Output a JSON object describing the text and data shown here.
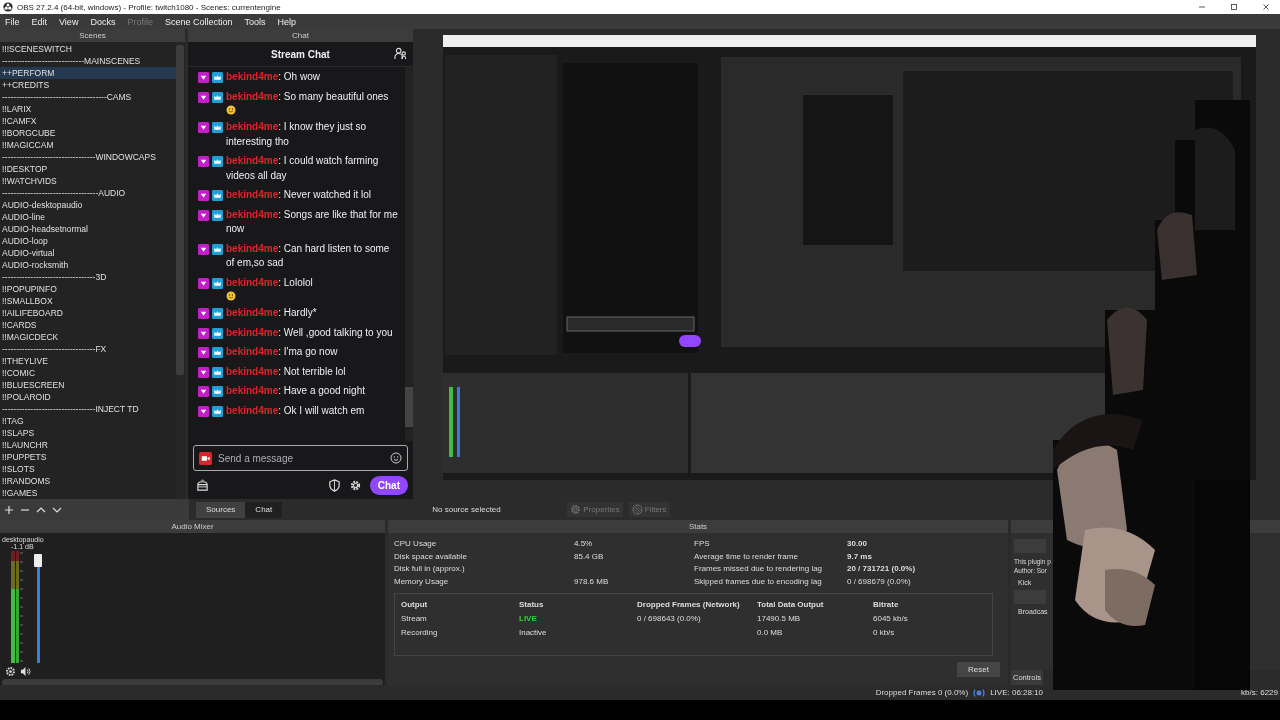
{
  "window": {
    "title": "OBS 27.2.4 (64-bit, windows) - Profile: twitch1080 - Scenes: currentengine"
  },
  "menu": [
    {
      "label": "File",
      "disabled": false
    },
    {
      "label": "Edit",
      "disabled": false
    },
    {
      "label": "View",
      "disabled": false
    },
    {
      "label": "Docks",
      "disabled": false
    },
    {
      "label": "Profile",
      "disabled": true
    },
    {
      "label": "Scene Collection",
      "disabled": false
    },
    {
      "label": "Tools",
      "disabled": false
    },
    {
      "label": "Help",
      "disabled": false
    }
  ],
  "scenes": {
    "title": "Scenes",
    "items": [
      {
        "label": "!!!SCENESWITCH",
        "selected": false
      },
      {
        "label": "-----------------------------MAINSCENES",
        "selected": false
      },
      {
        "label": "++PERFORM",
        "selected": true
      },
      {
        "label": "++CREDITS",
        "selected": false
      },
      {
        "label": "-------------------------------------CAMS",
        "selected": false
      },
      {
        "label": "!!LARIX",
        "selected": false
      },
      {
        "label": "!!CAMFX",
        "selected": false
      },
      {
        "label": "!!BORGCUBE",
        "selected": false
      },
      {
        "label": "!!MAGICCAM",
        "selected": false
      },
      {
        "label": "---------------------------------WINDOWCAPS",
        "selected": false
      },
      {
        "label": "!!DESKTOP",
        "selected": false
      },
      {
        "label": "!!WATCHVIDS",
        "selected": false
      },
      {
        "label": "----------------------------------AUDIO",
        "selected": false
      },
      {
        "label": "AUDIO-desktopaudio",
        "selected": false
      },
      {
        "label": "AUDIO-line",
        "selected": false
      },
      {
        "label": "AUDIO-headsetnormal",
        "selected": false
      },
      {
        "label": "AUDIO-loop",
        "selected": false
      },
      {
        "label": "AUDIO-virtual",
        "selected": false
      },
      {
        "label": "AUDIO-rocksmith",
        "selected": false
      },
      {
        "label": "---------------------------------3D",
        "selected": false
      },
      {
        "label": "!!POPUPINFO",
        "selected": false
      },
      {
        "label": "!!SMALLBOX",
        "selected": false
      },
      {
        "label": "!!AILIFEBOARD",
        "selected": false
      },
      {
        "label": "!!CARDS",
        "selected": false
      },
      {
        "label": "!!MAGICDECK",
        "selected": false
      },
      {
        "label": "---------------------------------FX",
        "selected": false
      },
      {
        "label": "!!THEYLIVE",
        "selected": false
      },
      {
        "label": "!!COMIC",
        "selected": false
      },
      {
        "label": "!!BLUESCREEN",
        "selected": false
      },
      {
        "label": "!!POLAROID",
        "selected": false
      },
      {
        "label": "---------------------------------INJECT TD",
        "selected": false
      },
      {
        "label": "!!TAG",
        "selected": false
      },
      {
        "label": "!!SLAPS",
        "selected": false
      },
      {
        "label": "!!LAUNCHR",
        "selected": false
      },
      {
        "label": "!!PUPPETS",
        "selected": false
      },
      {
        "label": "!!SLOTS",
        "selected": false
      },
      {
        "label": "!!RANDOMS",
        "selected": false
      },
      {
        "label": "!!GAMES",
        "selected": false
      }
    ]
  },
  "chat": {
    "title": "Chat",
    "header": "Stream Chat",
    "messages": [
      {
        "user": "bekind4me",
        "text": ": Oh wow",
        "emoji": false
      },
      {
        "user": "bekind4me",
        "text": ": So many beautiful ones",
        "emoji": true
      },
      {
        "user": "bekind4me",
        "text": ": I know they just so interesting tho",
        "emoji": false
      },
      {
        "user": "bekind4me",
        "text": ": I could watch farming videos all day",
        "emoji": false
      },
      {
        "user": "bekind4me",
        "text": ": Never watched it lol",
        "emoji": false
      },
      {
        "user": "bekind4me",
        "text": ": Songs are like that for me now",
        "emoji": false
      },
      {
        "user": "bekind4me",
        "text": ": Can hard listen to some of em,so sad",
        "emoji": false
      },
      {
        "user": "bekind4me",
        "text": ": Lololol",
        "emoji": true
      },
      {
        "user": "bekind4me",
        "text": ": Hardly*",
        "emoji": false
      },
      {
        "user": "bekind4me",
        "text": ": Well ,good talking to you",
        "emoji": false
      },
      {
        "user": "bekind4me",
        "text": ": I'ma go now",
        "emoji": false
      },
      {
        "user": "bekind4me",
        "text": ": Not terrible lol",
        "emoji": false
      },
      {
        "user": "bekind4me",
        "text": ": Have a good night",
        "emoji": false
      },
      {
        "user": "bekind4me",
        "text": ": Ok I will watch em",
        "emoji": false
      }
    ],
    "input": {
      "placeholder": "Send a message"
    },
    "send_button": "Chat"
  },
  "dock_tabs": [
    {
      "label": "Sources",
      "selected": true
    },
    {
      "label": "Chat",
      "selected": false
    }
  ],
  "source_toolbar": {
    "status": "No source selected",
    "buttons": [
      "Properties",
      "Filters"
    ]
  },
  "audio_mixer": {
    "title": "Audio Mixer",
    "channel": "desktopaudio",
    "reading": "-1.1 dB",
    "level": 0.97
  },
  "stats": {
    "title": "Stats",
    "left": [
      {
        "label": "CPU Usage",
        "value": "4.5%"
      },
      {
        "label": "Disk space available",
        "value": "85.4 GB"
      },
      {
        "label": "Disk full in (approx.)"
      },
      {
        "label": "Memory Usage",
        "value": "978.6 MB"
      }
    ],
    "right": [
      {
        "label": "FPS",
        "value": "30.00",
        "emphasis": true
      },
      {
        "label": "Average time to render frame",
        "value": "9.7 ms",
        "emphasis": true
      },
      {
        "label": "Frames missed due to rendering lag",
        "value": "20 / 731721 (0.0%)",
        "emphasis": true
      },
      {
        "label": "Skipped frames due to encoding lag",
        "value": "0 / 698679 (0.0%)",
        "emphasis": false
      }
    ],
    "columns": [
      "Output",
      "Status",
      "Dropped Frames (Network)",
      "Total Data Output",
      "Bitrate"
    ],
    "rows": [
      {
        "output": "Stream",
        "status": "LIVE",
        "live": true,
        "dropped": "0 / 698643 (0.0%)",
        "total": "17490.5 MB",
        "bitrate": "6045 kb/s"
      },
      {
        "output": "Recording",
        "status": "Inactive",
        "live": false,
        "total": "0.0 MB",
        "bitrate": "0 kb/s"
      }
    ],
    "reset_button": "Reset"
  },
  "controls": {
    "text": [
      "This plugin p",
      "Author: Sor"
    ],
    "labels": [
      "Kick",
      "Broadcas"
    ],
    "tab": "Controls"
  },
  "status_bar": {
    "dropped": "Dropped Frames 0 (0.0%)",
    "live": "LIVE: 06:28:10",
    "bitrate": "kb/s: 6229"
  }
}
